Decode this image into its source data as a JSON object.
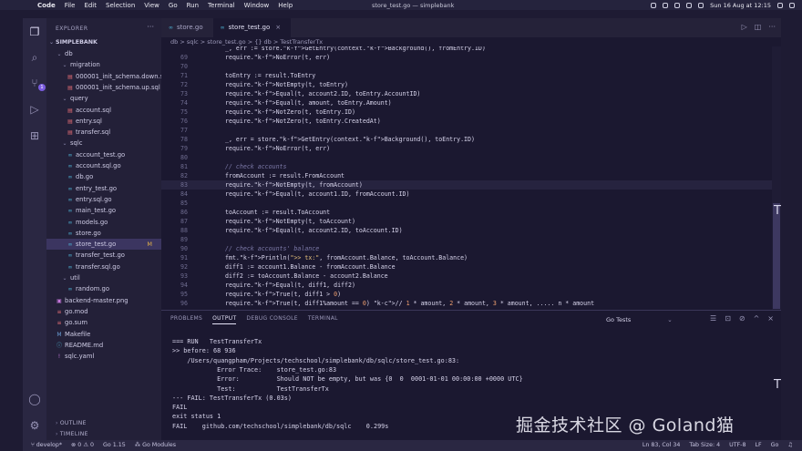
{
  "menubar": {
    "apple": "",
    "app": "Code",
    "items": [
      "File",
      "Edit",
      "Selection",
      "View",
      "Go",
      "Run",
      "Terminal",
      "Window",
      "Help"
    ],
    "window_title": "store_test.go — simplebank",
    "datetime": "Sun 16 Aug at 12:15"
  },
  "sidebar": {
    "title": "EXPLORER",
    "root": "SIMPLEBANK",
    "items": [
      {
        "label": "db",
        "indent": 1,
        "kind": "folder-open"
      },
      {
        "label": "migration",
        "indent": 2,
        "kind": "folder-open"
      },
      {
        "label": "000001_init_schema.down.sql",
        "indent": 3,
        "kind": "sql"
      },
      {
        "label": "000001_init_schema.up.sql",
        "indent": 3,
        "kind": "sql"
      },
      {
        "label": "query",
        "indent": 2,
        "kind": "folder-open"
      },
      {
        "label": "account.sql",
        "indent": 3,
        "kind": "sql"
      },
      {
        "label": "entry.sql",
        "indent": 3,
        "kind": "sql"
      },
      {
        "label": "transfer.sql",
        "indent": 3,
        "kind": "sql"
      },
      {
        "label": "sqlc",
        "indent": 2,
        "kind": "folder-open"
      },
      {
        "label": "account_test.go",
        "indent": 3,
        "kind": "go"
      },
      {
        "label": "account.sql.go",
        "indent": 3,
        "kind": "go"
      },
      {
        "label": "db.go",
        "indent": 3,
        "kind": "go"
      },
      {
        "label": "entry_test.go",
        "indent": 3,
        "kind": "go"
      },
      {
        "label": "entry.sql.go",
        "indent": 3,
        "kind": "go"
      },
      {
        "label": "main_test.go",
        "indent": 3,
        "kind": "go"
      },
      {
        "label": "models.go",
        "indent": 3,
        "kind": "go"
      },
      {
        "label": "store.go",
        "indent": 3,
        "kind": "go"
      },
      {
        "label": "store_test.go",
        "indent": 3,
        "kind": "go",
        "selected": true,
        "mark": "M"
      },
      {
        "label": "transfer_test.go",
        "indent": 3,
        "kind": "go"
      },
      {
        "label": "transfer.sql.go",
        "indent": 3,
        "kind": "go"
      },
      {
        "label": "util",
        "indent": 2,
        "kind": "folder-open"
      },
      {
        "label": "random.go",
        "indent": 3,
        "kind": "go"
      },
      {
        "label": "backend-master.png",
        "indent": 1,
        "kind": "img"
      },
      {
        "label": "go.mod",
        "indent": 1,
        "kind": "mod"
      },
      {
        "label": "go.sum",
        "indent": 1,
        "kind": "mod"
      },
      {
        "label": "Makefile",
        "indent": 1,
        "kind": "make"
      },
      {
        "label": "README.md",
        "indent": 1,
        "kind": "md"
      },
      {
        "label": "sqlc.yaml",
        "indent": 1,
        "kind": "yaml"
      }
    ],
    "outline": "OUTLINE",
    "timeline": "TIMELINE"
  },
  "tabs": [
    {
      "label": "store.go",
      "active": false
    },
    {
      "label": "store_test.go",
      "active": true
    }
  ],
  "breadcrumb": "db > sqlc > store_test.go > {} db > TestTransferTx",
  "editor": {
    "lines": [
      {
        "n": "",
        "t": "_, err := store.GetEntry(context.Background(), fromEntry.ID)",
        "cls": "p"
      },
      {
        "n": "69",
        "t": "require.NoError(t, err)",
        "cls": "p"
      },
      {
        "n": "70",
        "t": "",
        "cls": "p"
      },
      {
        "n": "71",
        "t": "toEntry := result.ToEntry",
        "cls": "p"
      },
      {
        "n": "72",
        "t": "require.NotEmpty(t, toEntry)",
        "cls": "p"
      },
      {
        "n": "73",
        "t": "require.Equal(t, account2.ID, toEntry.AccountID)",
        "cls": "p"
      },
      {
        "n": "74",
        "t": "require.Equal(t, amount, toEntry.Amount)",
        "cls": "p"
      },
      {
        "n": "75",
        "t": "require.NotZero(t, toEntry.ID)",
        "cls": "p"
      },
      {
        "n": "76",
        "t": "require.NotZero(t, toEntry.CreatedAt)",
        "cls": "p"
      },
      {
        "n": "77",
        "t": "",
        "cls": "p"
      },
      {
        "n": "78",
        "t": "_, err = store.GetEntry(context.Background(), toEntry.ID)",
        "cls": "p"
      },
      {
        "n": "79",
        "t": "require.NoError(t, err)",
        "cls": "p"
      },
      {
        "n": "80",
        "t": "",
        "cls": "p"
      },
      {
        "n": "81",
        "t": "// check accounts",
        "cls": "c"
      },
      {
        "n": "82",
        "t": "fromAccount := result.FromAccount",
        "cls": "p"
      },
      {
        "n": "83",
        "t": "require.NotEmpty(t, fromAccount)",
        "cls": "p",
        "cur": true
      },
      {
        "n": "84",
        "t": "require.Equal(t, account1.ID, fromAccount.ID)",
        "cls": "p"
      },
      {
        "n": "85",
        "t": "",
        "cls": "p"
      },
      {
        "n": "86",
        "t": "toAccount := result.ToAccount",
        "cls": "p"
      },
      {
        "n": "87",
        "t": "require.NotEmpty(t, toAccount)",
        "cls": "p"
      },
      {
        "n": "88",
        "t": "require.Equal(t, account2.ID, toAccount.ID)",
        "cls": "p"
      },
      {
        "n": "89",
        "t": "",
        "cls": "p"
      },
      {
        "n": "90",
        "t": "// check accounts' balance",
        "cls": "c"
      },
      {
        "n": "91",
        "t": "fmt.Println(\">> tx:\", fromAccount.Balance, toAccount.Balance)",
        "cls": "p"
      },
      {
        "n": "92",
        "t": "diff1 := account1.Balance - fromAccount.Balance",
        "cls": "p"
      },
      {
        "n": "93",
        "t": "diff2 := toAccount.Balance - account2.Balance",
        "cls": "p"
      },
      {
        "n": "94",
        "t": "require.Equal(t, diff1, diff2)",
        "cls": "p"
      },
      {
        "n": "95",
        "t": "require.True(t, diff1 > 0)",
        "cls": "p"
      },
      {
        "n": "96",
        "t": "require.True(t, diff1%amount == 0) // 1 * amount, 2 * amount, 3 * amount, ..... n * amount",
        "cls": "p"
      }
    ]
  },
  "panel": {
    "tabs": [
      "PROBLEMS",
      "OUTPUT",
      "DEBUG CONSOLE",
      "TERMINAL"
    ],
    "active_tab": "OUTPUT",
    "select": "Go Tests",
    "output": [
      "=== RUN   TestTransferTx",
      ">> before: 68 936",
      "    /Users/quangpham/Projects/techschool/simplebank/db/sqlc/store_test.go:83:",
      "            Error Trace:    store_test.go:83",
      "            Error:          Should NOT be empty, but was {0  0  0001-01-01 00:00:00 +0000 UTC}",
      "            Test:           TestTransferTx",
      "--- FAIL: TestTransferTx (0.03s)",
      "FAIL",
      "exit status 1",
      "FAIL    github.com/techschool/simplebank/db/sqlc    0.299s"
    ]
  },
  "statusbar": {
    "branch": "develop*",
    "errors": "0",
    "warnings": "0",
    "go_version": "Go 1.15",
    "modules": "Go Modules",
    "position": "Ln 83, Col 34",
    "tab_size": "Tab Size: 4",
    "encoding": "UTF-8",
    "eol": "LF",
    "language": "Go"
  },
  "watermark": "掘金技术社区 @ Goland猫"
}
